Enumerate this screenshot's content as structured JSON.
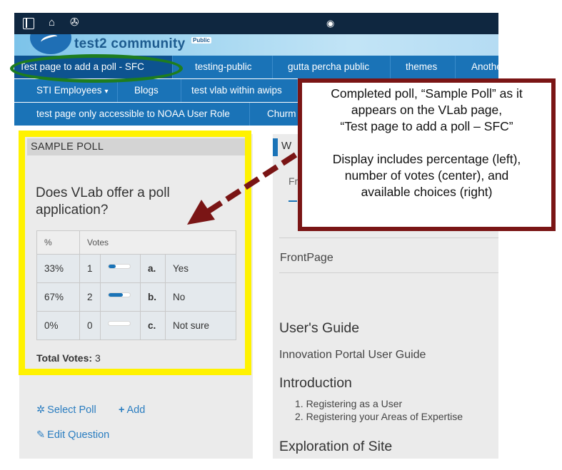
{
  "browser": {
    "icons": [
      "sidebar-toggle-icon",
      "home-icon",
      "palette-icon",
      "eye-icon"
    ],
    "home_glyph": "⌂",
    "palette_glyph": "✇",
    "eye_glyph": "◉"
  },
  "site": {
    "community_name": "test2 community",
    "public_badge": "Public"
  },
  "nav": {
    "row1": [
      "Test page to add a poll - SFC",
      "testing-public",
      "gutta percha public",
      "themes",
      "Anothe"
    ],
    "row2": [
      "STI Employees",
      "Blogs",
      "test vlab within awips"
    ],
    "row3": [
      "test page only accessible to NOAA User Role",
      "Churm"
    ],
    "caret": "▾"
  },
  "poll": {
    "title": "SAMPLE POLL",
    "question": "Does VLab offer a poll application?",
    "headers": {
      "percent": "%",
      "votes": "Votes"
    },
    "choices": [
      {
        "percent": "33%",
        "votes": "1",
        "fraction": 0.33,
        "letter": "a.",
        "label": "Yes"
      },
      {
        "percent": "67%",
        "votes": "2",
        "fraction": 0.67,
        "letter": "b.",
        "label": "No"
      },
      {
        "percent": "0%",
        "votes": "0",
        "fraction": 0.0,
        "letter": "c.",
        "label": "Not sure"
      }
    ],
    "total_label": "Total Votes:",
    "total_value": "3",
    "actions": {
      "select_poll": "Select Poll",
      "add": "Add",
      "edit_question": "Edit Question"
    }
  },
  "content": {
    "header_fragment": "W",
    "tab_fragment": "Fr",
    "frontpage": "FrontPage",
    "users_guide": "User's Guide",
    "portal_guide": "Innovation Portal User Guide",
    "introduction": "Introduction",
    "intro_items": [
      "1. Registering as a User",
      "2. Registering your Areas of Expertise"
    ],
    "exploration": "Exploration of Site"
  },
  "annotation": {
    "line1": "Completed poll, “Sample Poll” as it",
    "line2": "appears on the VLab page,",
    "line3": "“Test page to add a poll – SFC”",
    "line4": "Display includes percentage (left),",
    "line5": "number of votes (center), and",
    "line6": "available choices (right)"
  },
  "colors": {
    "nav_blue": "#1a73b7",
    "nav_active": "#0d5390",
    "highlight_yellow": "#fff200",
    "oval_green": "#1e7d1e",
    "callout_border": "#7a1515"
  }
}
